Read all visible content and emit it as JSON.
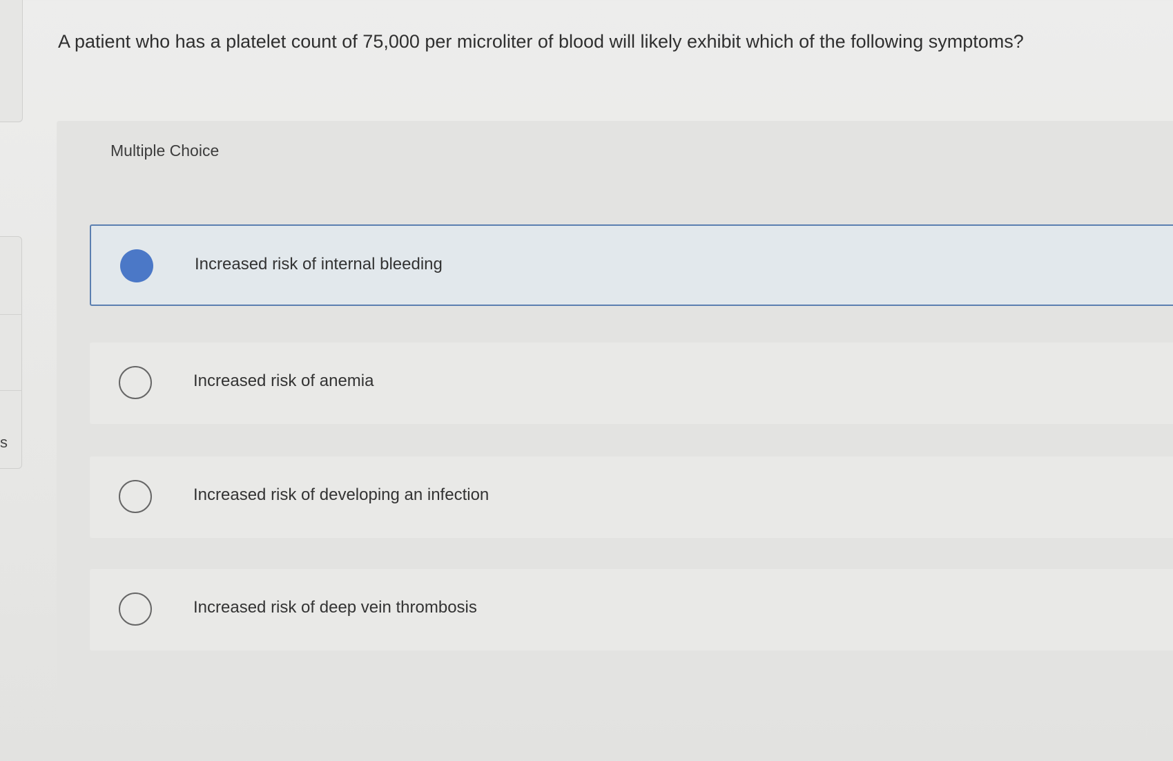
{
  "edge": {
    "letter": "s"
  },
  "question": {
    "text": "A patient who has a platelet count of 75,000 per microliter of blood will likely exhibit which of the following symptoms?"
  },
  "answer_section": {
    "type_label": "Multiple Choice",
    "options": [
      {
        "label": "Increased risk of internal bleeding",
        "selected": true
      },
      {
        "label": "Increased risk of anemia",
        "selected": false
      },
      {
        "label": "Increased risk of developing an infection",
        "selected": false
      },
      {
        "label": "Increased risk of deep vein thrombosis",
        "selected": false
      }
    ]
  },
  "colors": {
    "selected_radio": "#4b78c7",
    "selected_border": "#5b7fb0",
    "selected_background": "#e2e8ec"
  }
}
